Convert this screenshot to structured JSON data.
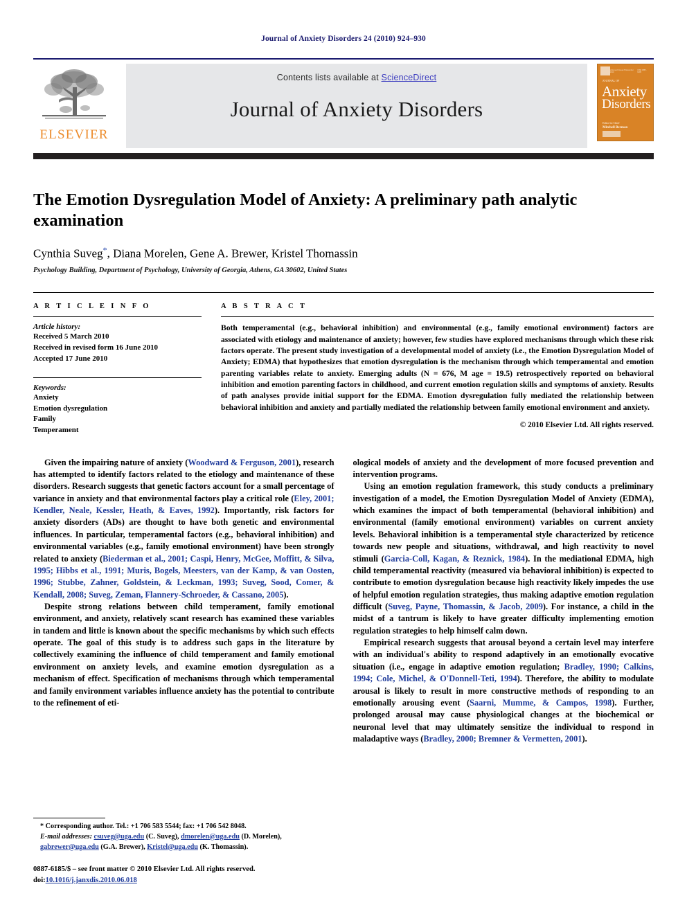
{
  "running_head": "Journal of Anxiety Disorders 24 (2010) 924–930",
  "masthead": {
    "contents_prefix": "Contents lists available at ",
    "sciencedirect": "ScienceDirect",
    "journal_name": "Journal of Anxiety Disorders",
    "publisher": "ELSEVIER",
    "cover": {
      "top_left": "Volume 24  Issue 8  December 2010",
      "top_right": "ISSN 0887-6185",
      "pre_title": "JOURNAL OF",
      "title_line1": "Anxiety",
      "title_line2": "Disorders",
      "editor_label": "Editor-in-Chief",
      "editor_name": "Mitchell Berman"
    }
  },
  "article": {
    "title": "The Emotion Dysregulation Model of Anxiety: A preliminary path analytic examination",
    "authors": "Cynthia Suveg",
    "authors_rest": ", Diana Morelen, Gene A. Brewer, Kristel Thomassin",
    "corresponding_marker": "*",
    "affiliation": "Psychology Building, Department of Psychology, University of Georgia, Athens, GA 30602, United States"
  },
  "info": {
    "heading": "A R T I C L E   I N F O",
    "history_label": "Article history:",
    "history": [
      "Received 5 March 2010",
      "Received in revised form 16 June 2010",
      "Accepted 17 June 2010"
    ],
    "keywords_label": "Keywords:",
    "keywords": [
      "Anxiety",
      "Emotion dysregulation",
      "Family",
      "Temperament"
    ]
  },
  "abstract": {
    "heading": "A B S T R A C T",
    "text": "Both temperamental (e.g., behavioral inhibition) and environmental (e.g., family emotional environment) factors are associated with etiology and maintenance of anxiety; however, few studies have explored mechanisms through which these risk factors operate. The present study investigation of a developmental model of anxiety (i.e., the Emotion Dysregulation Model of Anxiety; EDMA) that hypothesizes that emotion dysregulation is the mechanism through which temperamental and emotion parenting variables relate to anxiety. Emerging adults (N = 676, M age = 19.5) retrospectively reported on behavioral inhibition and emotion parenting factors in childhood, and current emotion regulation skills and symptoms of anxiety. Results of path analyses provide initial support for the EDMA. Emotion dysregulation fully mediated the relationship between behavioral inhibition and anxiety and partially mediated the relationship between family emotional environment and anxiety.",
    "copyright": "© 2010 Elsevier Ltd. All rights reserved."
  },
  "body": {
    "left": [
      {
        "parts": [
          {
            "t": "Given the impairing nature of anxiety (",
            "c": false
          },
          {
            "t": "Woodward & Ferguson, 2001",
            "c": true
          },
          {
            "t": "), research has attempted to identify factors related to the etiology and maintenance of these disorders. Research suggests that genetic factors account for a small percentage of variance in anxiety and that environmental factors play a critical role (",
            "c": false
          },
          {
            "t": "Eley, 2001; Kendler, Neale, Kessler, Heath, & Eaves, 1992",
            "c": true
          },
          {
            "t": "). Importantly, risk factors for anxiety disorders (ADs) are thought to have both genetic and environmental influences. In particular, temperamental factors (e.g., behavioral inhibition) and environmental variables (e.g., family emotional environment) have been strongly related to anxiety (",
            "c": false
          },
          {
            "t": "Biederman et al., 2001; Caspi, Henry, McGee, Moffitt, & Silva, 1995; Hibbs et al., 1991; Muris, Bogels, Meesters, van der Kamp, & van Oosten, 1996; Stubbe, Zahner, Goldstein, & Leckman, 1993; Suveg, Sood, Comer, & Kendall, 2008; Suveg, Zeman, Flannery-Schroeder, & Cassano, 2005",
            "c": true
          },
          {
            "t": ").",
            "c": false
          }
        ]
      },
      {
        "parts": [
          {
            "t": "Despite strong relations between child temperament, family emotional environment, and anxiety, relatively scant research has examined these variables in tandem and little is known about the specific mechanisms by which such effects operate. The goal of this study is to address such gaps in the literature by collectively examining the influence of child temperament and family emotional environment on anxiety levels, and examine emotion dysregulation as a mechanism of effect. Specification of mechanisms through which temperamental and family environment variables influence anxiety has the potential to contribute to the refinement of eti-",
            "c": false
          }
        ]
      }
    ],
    "right": [
      {
        "no_indent": true,
        "parts": [
          {
            "t": "ological models of anxiety and the development of more focused prevention and intervention programs.",
            "c": false
          }
        ]
      },
      {
        "parts": [
          {
            "t": "Using an emotion regulation framework, this study conducts a preliminary investigation of a model, the Emotion Dysregulation Model of Anxiety (EDMA), which examines the impact of both temperamental (behavioral inhibition) and environmental (family emotional environment) variables on current anxiety levels. Behavioral inhibition is a temperamental style characterized by reticence towards new people and situations, withdrawal, and high reactivity to novel stimuli (",
            "c": false
          },
          {
            "t": "Garcia-Coll, Kagan, & Reznick, 1984",
            "c": true
          },
          {
            "t": "). In the mediational EDMA, high child temperamental reactivity (measured via behavioral inhibition) is expected to contribute to emotion dysregulation because high reactivity likely impedes the use of helpful emotion regulation strategies, thus making adaptive emotion regulation difficult (",
            "c": false
          },
          {
            "t": "Suveg, Payne, Thomassin, & Jacob, 2009",
            "c": true
          },
          {
            "t": "). For instance, a child in the midst of a tantrum is likely to have greater difficulty implementing emotion regulation strategies to help himself calm down.",
            "c": false
          }
        ]
      },
      {
        "parts": [
          {
            "t": "Empirical research suggests that arousal beyond a certain level may interfere with an individual's ability to respond adaptively in an emotionally evocative situation (i.e., engage in adaptive emotion regulation; ",
            "c": false
          },
          {
            "t": "Bradley, 1990; Calkins, 1994; Cole, Michel, & O'Donnell-Teti, 1994",
            "c": true
          },
          {
            "t": "). Therefore, the ability to modulate arousal is likely to result in more constructive methods of responding to an emotionally arousing event (",
            "c": false
          },
          {
            "t": "Saarni, Mumme, & Campos, 1998",
            "c": true
          },
          {
            "t": "). Further, prolonged arousal may cause physiological changes at the biochemical or neuronal level that may ultimately sensitize the individual to respond in maladaptive ways (",
            "c": false
          },
          {
            "t": "Bradley, 2000; Bremner & Vermetten, 2001",
            "c": true
          },
          {
            "t": ").",
            "c": false
          }
        ]
      }
    ]
  },
  "footnotes": {
    "corresponding": "* Corresponding author. Tel.: +1 706 583 5544; fax: +1 706 542 8048.",
    "email_label": "E-mail addresses:",
    "emails": [
      {
        "addr": "csuveg@uga.edu",
        "name": " (C. Suveg), "
      },
      {
        "addr": "dmorelen@uga.edu",
        "name": " (D. Morelen), "
      },
      {
        "addr": "gabrewer@uga.edu",
        "name": " (G.A. Brewer), "
      },
      {
        "addr": "Kristel@uga.edu",
        "name": " (K. Thomassin)."
      }
    ],
    "issn_line": "0887-6185/$ – see front matter © 2010 Elsevier Ltd. All rights reserved.",
    "doi_label": "doi:",
    "doi": "10.1016/j.janxdis.2010.06.018"
  }
}
